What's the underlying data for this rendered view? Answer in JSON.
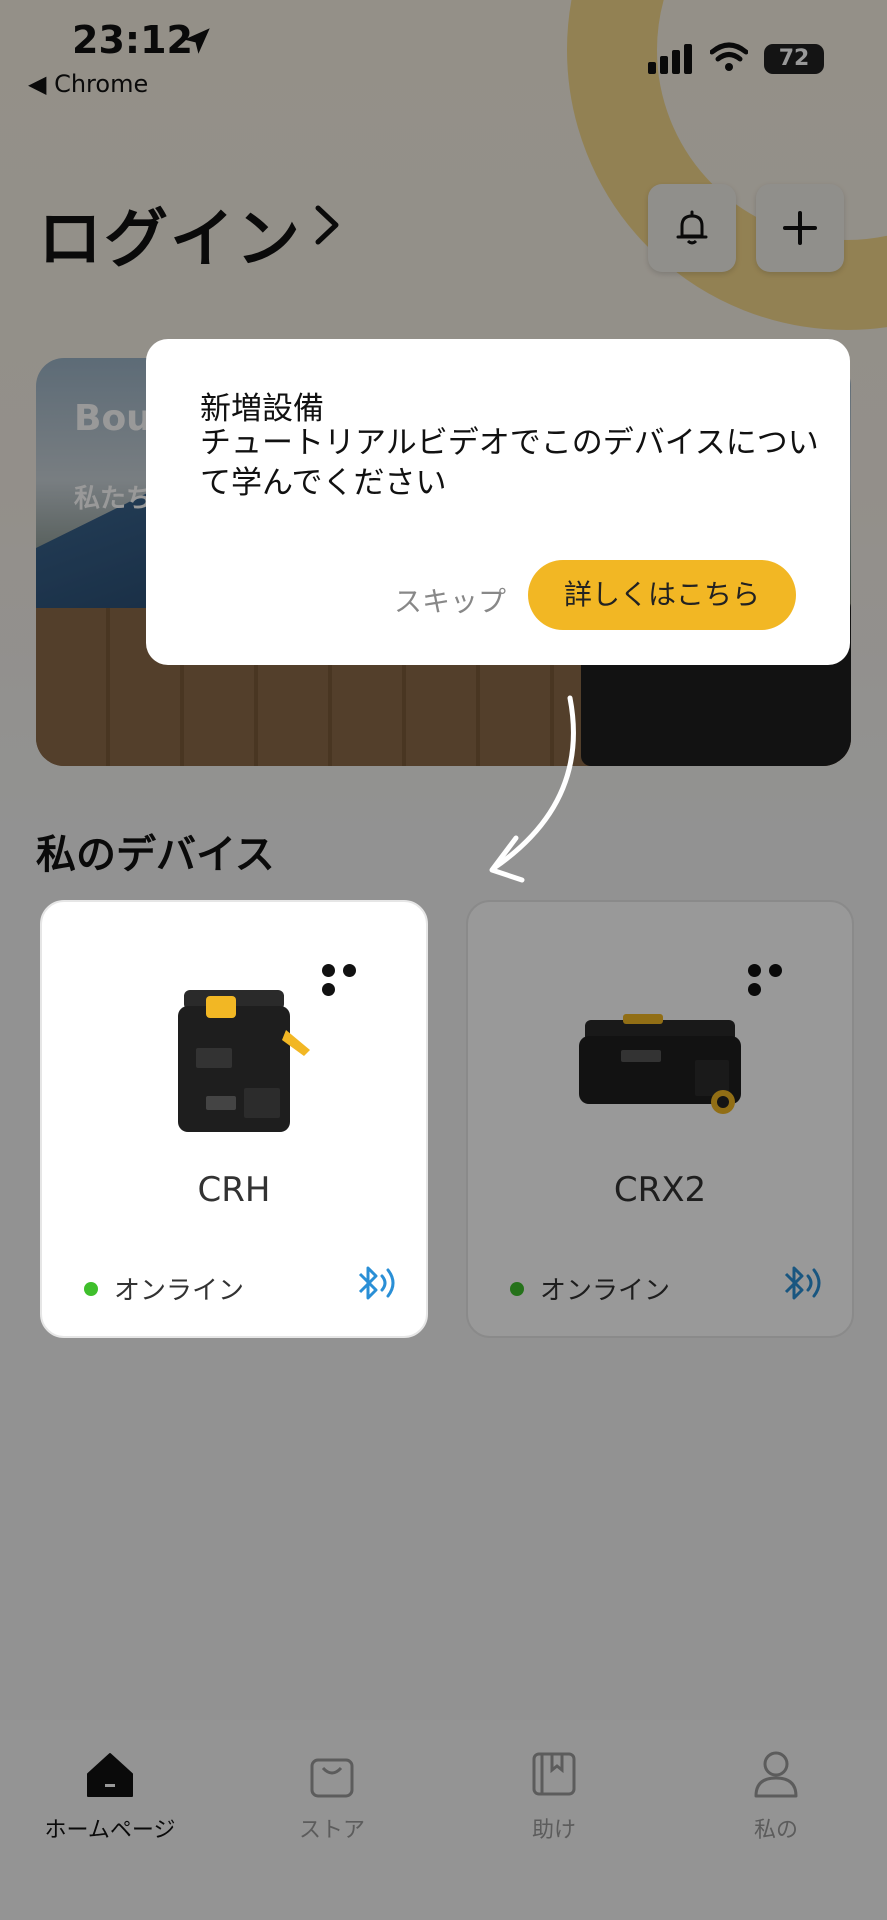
{
  "status_bar": {
    "time": "23:12",
    "back_app": "◀ Chrome",
    "battery": "72"
  },
  "header": {
    "title": "ログイン",
    "chevron": "›"
  },
  "banner": {
    "title": "Bou",
    "subtitle": "私たち"
  },
  "section": {
    "title": "私のデバイス"
  },
  "devices": [
    {
      "name": "CRH",
      "status": "オンライン",
      "status_color": "#3fbf2c"
    },
    {
      "name": "CRX2",
      "status": "オンライン",
      "status_color": "#3fbf2c"
    }
  ],
  "dialog": {
    "title": "新増設備",
    "body": "チュートリアルビデオでこのデバイスについて学んでください",
    "skip_label": "スキップ",
    "more_label": "詳しくはこちら"
  },
  "tabs": [
    {
      "label": "ホームページ",
      "icon": "home-icon",
      "active": true
    },
    {
      "label": "ストア",
      "icon": "bag-icon",
      "active": false
    },
    {
      "label": "助け",
      "icon": "book-icon",
      "active": false
    },
    {
      "label": "私の",
      "icon": "user-icon",
      "active": false
    }
  ],
  "colors": {
    "accent": "#f2b724",
    "online": "#3fbf2c",
    "bluetooth": "#2a8fd6"
  }
}
